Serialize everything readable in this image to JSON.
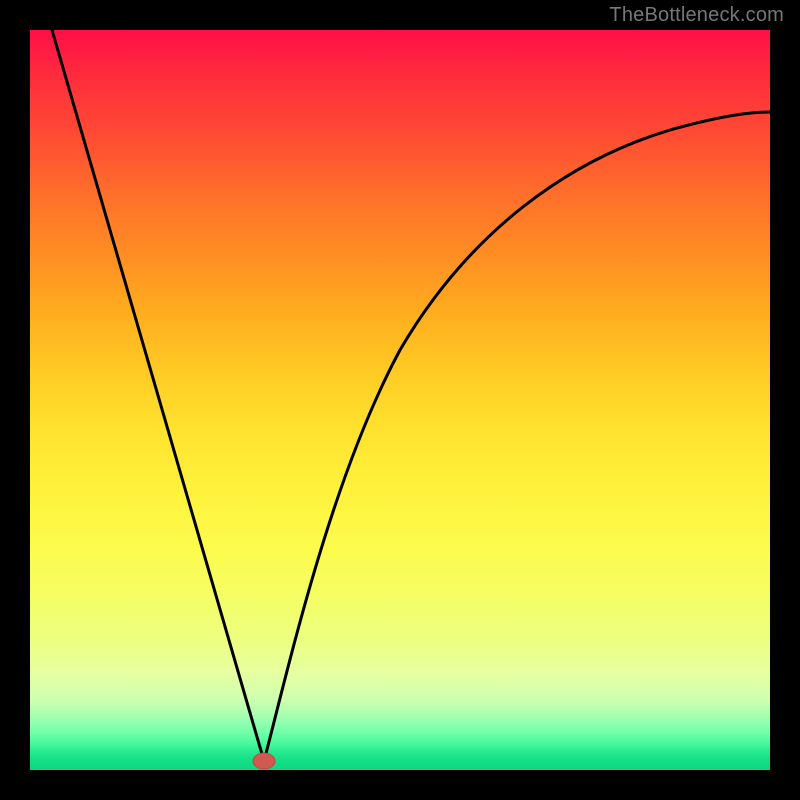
{
  "watermark": "TheBottleneck.com",
  "chart_data": {
    "type": "line",
    "title": "",
    "xlabel": "",
    "ylabel": "",
    "xlim": [
      0,
      1
    ],
    "ylim": [
      0,
      1
    ],
    "legend": false,
    "grid": false,
    "annotations": [
      {
        "name": "min-marker",
        "x": 0.317,
        "y": 0.012,
        "color": "#d05a52"
      }
    ],
    "background_gradient": {
      "direction": "vertical",
      "stops": [
        {
          "pos": 0.0,
          "color": "#ff0f47"
        },
        {
          "pos": 0.5,
          "color": "#ffd828"
        },
        {
          "pos": 0.8,
          "color": "#f2ff6a"
        },
        {
          "pos": 1.0,
          "color": "#0dd880"
        }
      ]
    },
    "series": [
      {
        "name": "left-branch",
        "x": [
          0.03,
          0.08,
          0.13,
          0.18,
          0.23,
          0.27,
          0.3,
          0.317
        ],
        "y": [
          1.0,
          0.82,
          0.64,
          0.47,
          0.3,
          0.16,
          0.06,
          0.012
        ]
      },
      {
        "name": "right-branch",
        "x": [
          0.317,
          0.34,
          0.38,
          0.43,
          0.49,
          0.56,
          0.64,
          0.73,
          0.82,
          0.91,
          1.0
        ],
        "y": [
          0.012,
          0.08,
          0.21,
          0.36,
          0.5,
          0.61,
          0.7,
          0.77,
          0.82,
          0.858,
          0.888
        ]
      }
    ]
  }
}
